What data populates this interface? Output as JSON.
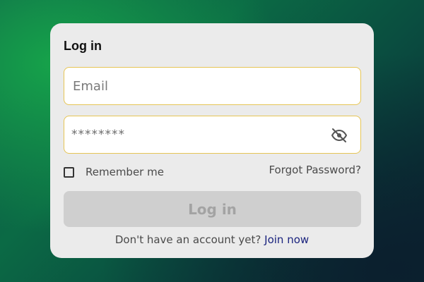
{
  "login_form": {
    "title": "Log in",
    "email": {
      "placeholder": "Email",
      "value": ""
    },
    "password": {
      "masked_value": "********",
      "toggle_icon": "eye-off-icon"
    },
    "remember_me_label": "Remember me",
    "remember_me_checked": false,
    "forgot_password_label": "Forgot Password?",
    "submit_label": "Log in",
    "signup_prompt": "Don't have an account yet?",
    "signup_link_label": "Join now"
  },
  "colors": {
    "field_border": "#e6c554",
    "card_background": "#ebebeb",
    "button_disabled": "#cfcfcf",
    "link": "#1a237e"
  }
}
